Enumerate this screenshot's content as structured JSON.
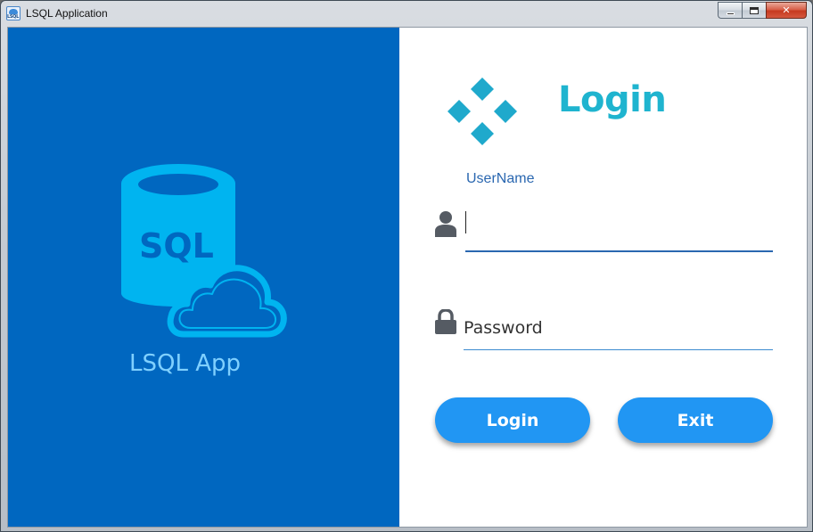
{
  "window": {
    "title": "LSQL Application",
    "icon": "lsql-app-icon"
  },
  "left_panel": {
    "background_color": "#0067c0",
    "illustration": {
      "icon": "sql-database-cloud-icon",
      "text": "SQL"
    },
    "brand_text": "LSQL App"
  },
  "right_panel": {
    "logo_icon": "four-diamond-logo-icon",
    "title": "Login",
    "username": {
      "label": "UserName",
      "icon": "user-icon",
      "value": ""
    },
    "password": {
      "icon": "lock-icon",
      "placeholder": "Password",
      "value": ""
    },
    "buttons": {
      "login": "Login",
      "exit": "Exit"
    }
  },
  "colors": {
    "accent": "#2196f3",
    "title": "#1fb4cf",
    "label": "#2a67b0",
    "brand_text": "#7fd0ff"
  }
}
